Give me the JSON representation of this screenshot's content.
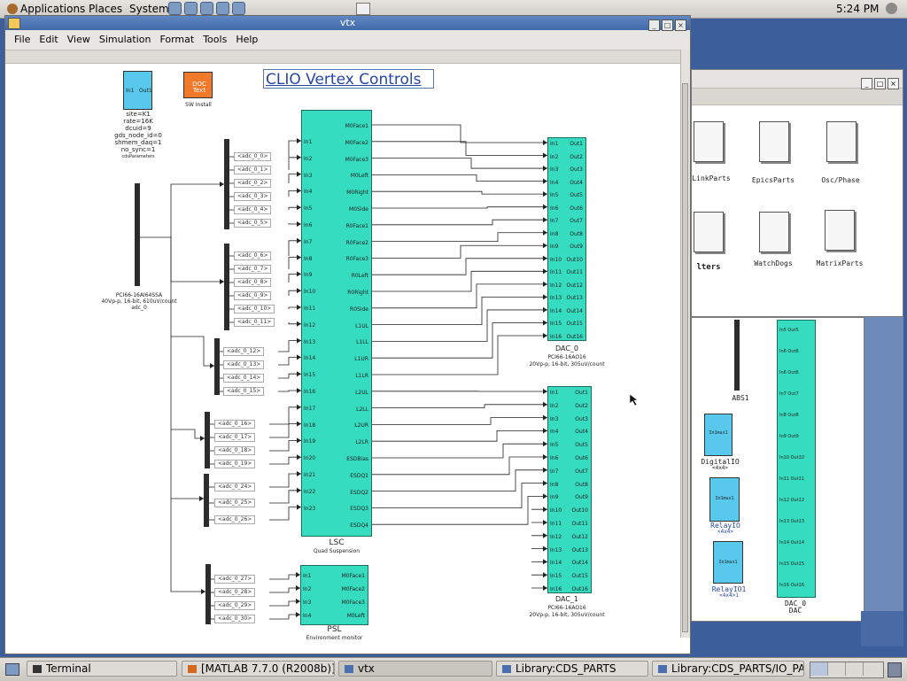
{
  "topPanel": {
    "menus": [
      "Applications",
      "Places",
      "System"
    ],
    "clock": "5:24 PM"
  },
  "mainWindow": {
    "title": "vtx",
    "menus": [
      "File",
      "Edit",
      "View",
      "Simulation",
      "Format",
      "Tools",
      "Help"
    ],
    "diagramTitle": "CLIO Vertex Controls",
    "ioBlock": {
      "in": "In1",
      "out": "Out1"
    },
    "docBlock": {
      "text": "DOC Text",
      "caption": "SW Install"
    },
    "paramText": [
      "site=K1",
      "rate=16K",
      "dcuid=9",
      "gds_node_id=0",
      "shmem_daq=1",
      "no_sync=1",
      "cdsParameters"
    ],
    "adcCaption": [
      "PCI66-16AI64SSA",
      "40Vp-p, 16-bit, 610uV/count",
      "adc_0"
    ],
    "adcTags": [
      "<adc_0_0>",
      "<adc_0_1>",
      "<adc_0_2>",
      "<adc_0_3>",
      "<adc_0_4>",
      "<adc_0_5>",
      "<adc_0_6>",
      "<adc_0_7>",
      "<adc_0_8>",
      "<adc_0_9>",
      "<adc_0_10>",
      "<adc_0_11>",
      "<adc_0_12>",
      "<adc_0_13>",
      "<adc_0_14>",
      "<adc_0_15>",
      "<adc_0_16>",
      "<adc_0_17>",
      "<adc_0_18>",
      "<adc_0_19>",
      "<adc_0_24>",
      "<adc_0_25>",
      "<adc_0_26>",
      "<adc_0_27>",
      "<adc_0_28>",
      "<adc_0_29>",
      "<adc_0_30>"
    ],
    "lsc": {
      "inputs": [
        "In1",
        "In2",
        "In3",
        "In4",
        "In5",
        "In6",
        "In7",
        "In8",
        "In9",
        "In10",
        "In11",
        "In12",
        "In13",
        "In14",
        "In15",
        "In16",
        "In17",
        "In18",
        "In19",
        "In20",
        "In21",
        "In22",
        "In23"
      ],
      "outputs": [
        "M0Face1",
        "M0Face2",
        "M0Face3",
        "M0Left",
        "M0Right",
        "M0Side",
        "R0Face1",
        "R0Face2",
        "R0Face3",
        "R0Left",
        "R0Right",
        "R0Side",
        "L1UL",
        "L1LL",
        "L1UR",
        "L1LR",
        "L2UL",
        "L2LL",
        "L2UR",
        "L2LR",
        "ESDBias",
        "ESDQ1",
        "ESDQ2",
        "ESDQ3",
        "ESDQ4"
      ],
      "caption": "LSC",
      "subcaption": "Quad Suspension"
    },
    "psl": {
      "inputs": [
        "In1",
        "In2",
        "In3",
        "In4"
      ],
      "outputs": [
        "M0Face1",
        "M0Face2",
        "M0Face3",
        "M0Left"
      ],
      "caption": "PSL",
      "subcaption": "Environment monitor"
    },
    "dac0": {
      "inputs": [
        "In1",
        "In2",
        "In3",
        "In4",
        "In5",
        "In6",
        "In7",
        "In8",
        "In9",
        "In10",
        "In11",
        "In12",
        "In13",
        "In14",
        "In15",
        "In16"
      ],
      "outputs": [
        "Out1",
        "Out2",
        "Out3",
        "Out4",
        "Out5",
        "Out6",
        "Out7",
        "Out8",
        "Out9",
        "Out10",
        "Out11",
        "Out12",
        "Out13",
        "Out14",
        "Out15",
        "Out16"
      ],
      "caption": [
        "DAC_0",
        "PCI66-16AO16",
        "20Vp-p, 16-bit, 305uV/count"
      ]
    },
    "dac1": {
      "inputs": [
        "In1",
        "In2",
        "In3",
        "In4",
        "In5",
        "In6",
        "In7",
        "In8",
        "In9",
        "In10",
        "In11",
        "In12",
        "In13",
        "In14",
        "In15",
        "In16"
      ],
      "outputs": [
        "Out1",
        "Out2",
        "Out3",
        "Out4",
        "Out5",
        "Out6",
        "Out7",
        "Out8",
        "Out9",
        "Out10",
        "Out11",
        "Out12",
        "Out13",
        "Out14",
        "Out15",
        "Out16"
      ],
      "caption": [
        "DAC_1",
        "PCI66-16AO16",
        "20Vp-p, 16-bit, 305uV/count"
      ]
    }
  },
  "libraryWindow": {
    "items": [
      "LinkParts",
      "EpicsParts",
      "Osc/Phase",
      "lters",
      "WatchDogs",
      "MatrixParts"
    ]
  },
  "ioWindow": {
    "items": [
      {
        "label": "DigitalIO",
        "sub": "<4x4>",
        "port": "In1mux1"
      },
      {
        "label": "RelayIO",
        "sub": "<4x4>",
        "port": "In1mux1"
      },
      {
        "label": "RelayIO1",
        "sub": "<4x4>1",
        "port": "In1mux1"
      }
    ],
    "absLabel": "ABS1",
    "dacLabel": [
      "DAC_0",
      "DAC"
    ],
    "dacRows": [
      "In5 Out5",
      "In6 Out6",
      "In6 Out6",
      "In7 Out7",
      "In8 Out8",
      "In9 Out9",
      "In10 Out10",
      "In11 Out11",
      "In12 Out12",
      "In13 Out13",
      "In14 Out14",
      "In15 Out15",
      "In16 Out16"
    ]
  },
  "taskbar": {
    "items": [
      "Terminal",
      "[MATLAB 7.7.0 (R2008b)]",
      "vtx",
      "Library:CDS_PARTS",
      "Library:CDS_PARTS/IO_PAR..."
    ]
  },
  "colors": {
    "block": "#36dcc0",
    "docBlock": "#f07a2a",
    "ioBlock": "#58c8ec",
    "title": "#2746a8"
  }
}
